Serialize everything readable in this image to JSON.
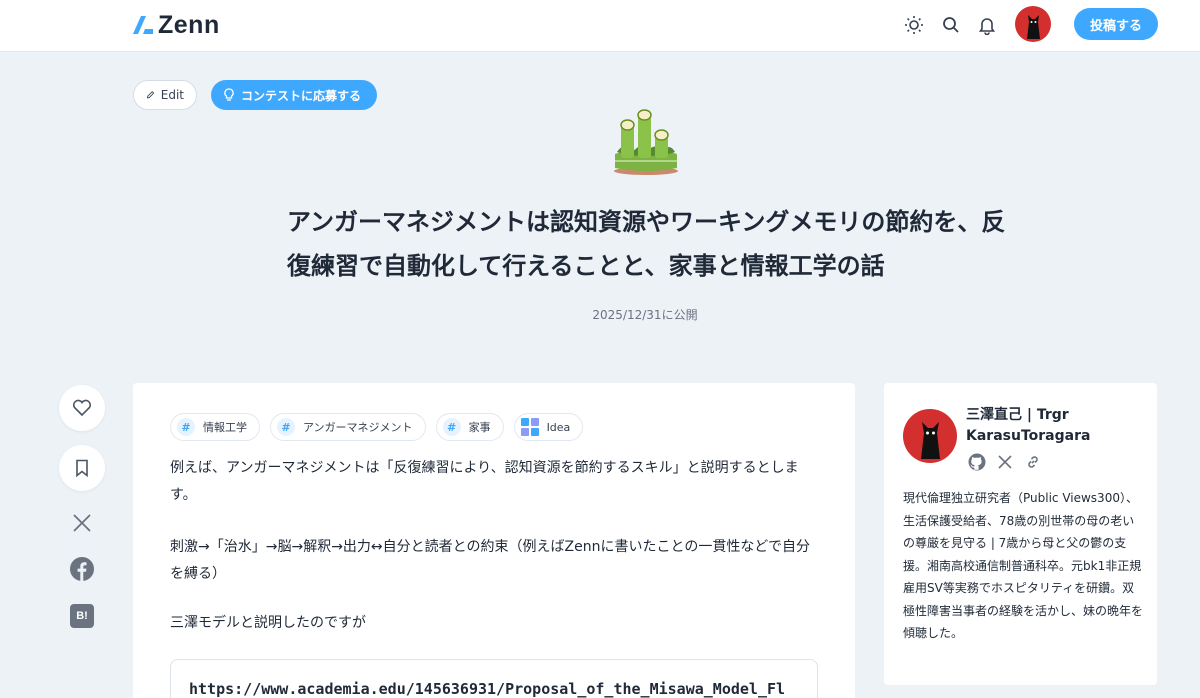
{
  "header": {
    "logo_text": "Zenn",
    "post_label": "投稿する",
    "icons": [
      "sun-icon",
      "search-icon",
      "bell-icon"
    ]
  },
  "actions": {
    "edit_label": "Edit",
    "contest_label": "コンテストに応募する"
  },
  "article": {
    "emoji": "kadomatsu",
    "title": "アンガーマネジメントは認知資源やワーキングメモリの節約を、反復練習で自動化して行えることと、家事と情報工学の話",
    "published": "2025/12/31に公開",
    "tags": [
      {
        "label": "情報工学",
        "icon": "hash"
      },
      {
        "label": "アンガーマネジメント",
        "icon": "hash"
      },
      {
        "label": "家事",
        "icon": "hash"
      },
      {
        "label": "Idea",
        "icon": "idea"
      }
    ],
    "paragraphs": [
      "例えば、アンガーマネジメントは「反復練習により、認知資源を節約するスキル」と説明するとします。",
      "刺激→「治水」→脳→解釈→出力↔自分と読者との約束（例えばZennに書いたことの一貫性などで自分を縛る）",
      "三澤モデルと説明したのですが"
    ],
    "link_url": "https://www.academia.edu/145636931/Proposal_of_the_Misawa_Model_Fl"
  },
  "share": {
    "icons": [
      "heart-icon",
      "bookmark-icon",
      "x-icon",
      "facebook-icon",
      "hatena-bookmark-icon"
    ],
    "hatena_label": "B!"
  },
  "author": {
    "name": "三澤直己 | Trgr KarasuToragara",
    "links": [
      "github-icon",
      "x-icon",
      "link-icon"
    ],
    "bio": "現代倫理独立研究者（Public Views300）、生活保護受給者、78歳の別世帯の母の老いの尊厳を見守る | 7歳から母と父の鬱の支援。湘南高校通信制普通科卒。元bk1非正規雇用SV等実務でホスピタリティを研鑽。双極性障害当事者の経験を活かし、妹の晩年を傾聴した。"
  },
  "colors": {
    "accent": "#3ea8ff",
    "background": "#edf2f7",
    "avatar_red": "#d32f2f"
  }
}
